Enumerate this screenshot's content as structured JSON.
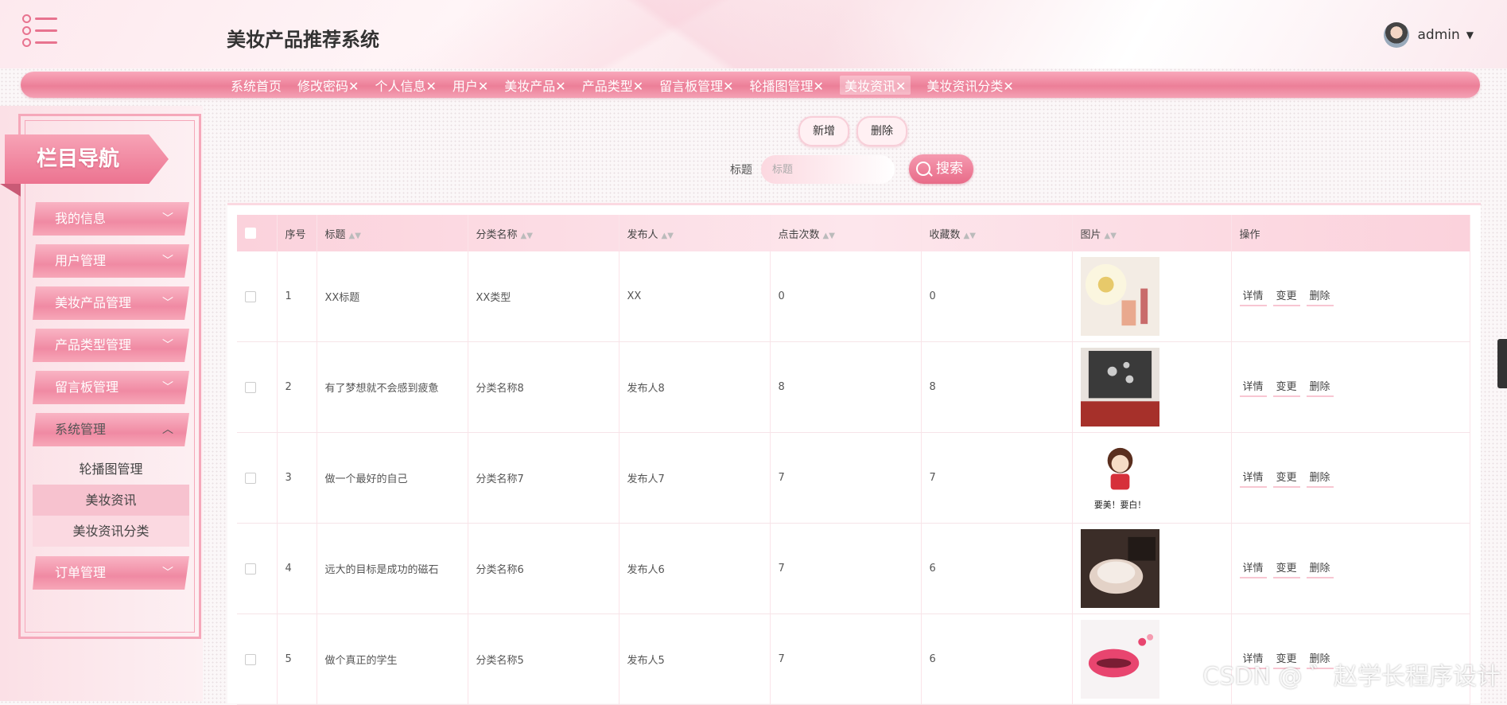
{
  "app": {
    "title": "美妆产品推荐系统",
    "user": "admin"
  },
  "topnav": [
    "系统首页",
    "修改密码✕",
    "个人信息✕",
    "用户✕",
    "美妆产品✕",
    "产品类型✕",
    "留言板管理✕",
    "轮播图管理✕",
    "美妆资讯✕",
    "美妆资讯分类✕"
  ],
  "sidebar": {
    "title": "栏目导航",
    "items": [
      {
        "label": "我的信息"
      },
      {
        "label": "用户管理"
      },
      {
        "label": "美妆产品管理"
      },
      {
        "label": "产品类型管理"
      },
      {
        "label": "留言板管理"
      },
      {
        "label": "系统管理"
      }
    ],
    "sub_items": [
      "轮播图管理",
      "美妆资讯",
      "美妆资讯分类"
    ],
    "last_item": {
      "label": "订单管理"
    }
  },
  "toolbar": {
    "add_label": "新增",
    "delete_label": "删除",
    "search_label": "标题",
    "search_placeholder": "标题",
    "search_button": "搜索"
  },
  "table": {
    "columns": [
      "序号",
      "标题",
      "分类名称",
      "发布人",
      "点击次数",
      "收藏数",
      "图片",
      "操作"
    ],
    "actions": [
      "详情",
      "变更",
      "删除"
    ],
    "rows": [
      {
        "no": "1",
        "title": "XX标题",
        "category": "XX类型",
        "publisher": "XX",
        "clicks": "0",
        "favorites": "0"
      },
      {
        "no": "2",
        "title": "有了梦想就不会感到疲惫",
        "category": "分类名称8",
        "publisher": "发布人8",
        "clicks": "8",
        "favorites": "8"
      },
      {
        "no": "3",
        "title": "做一个最好的自己",
        "category": "分类名称7",
        "publisher": "发布人7",
        "clicks": "7",
        "favorites": "7",
        "image_caption": "要美！要白！"
      },
      {
        "no": "4",
        "title": "远大的目标是成功的磁石",
        "category": "分类名称6",
        "publisher": "发布人6",
        "clicks": "7",
        "favorites": "6"
      },
      {
        "no": "5",
        "title": "做个真正的学生",
        "category": "分类名称5",
        "publisher": "发布人5",
        "clicks": "7",
        "favorites": "6"
      }
    ]
  },
  "watermark": "CSDN @ ゛赵学长程序设计"
}
